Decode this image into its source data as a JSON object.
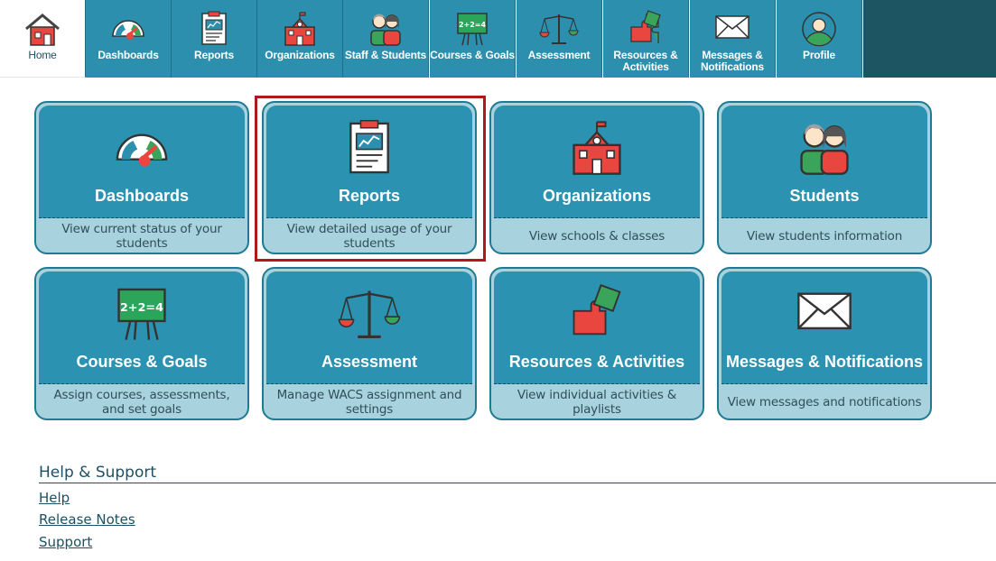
{
  "nav": {
    "items": [
      {
        "label": "Home",
        "icon": "house-icon",
        "active": true
      },
      {
        "label": "Dashboards",
        "icon": "gauge-icon"
      },
      {
        "label": "Reports",
        "icon": "report-clipboard-icon"
      },
      {
        "label": "Organizations",
        "icon": "school-building-icon"
      },
      {
        "label": "Staff & Students",
        "icon": "people-icon"
      },
      {
        "label": "Courses & Goals",
        "icon": "chalkboard-icon"
      },
      {
        "label": "Assessment",
        "icon": "scale-icon"
      },
      {
        "label": "Resources & Activities",
        "icon": "puzzle-icon"
      },
      {
        "label": "Messages & Notifications",
        "icon": "envelope-icon"
      },
      {
        "label": "Profile",
        "icon": "profile-icon"
      }
    ]
  },
  "tiles": [
    {
      "title": "Dashboards",
      "desc": "View current status of your students",
      "icon": "gauge-icon"
    },
    {
      "title": "Reports",
      "desc": "View detailed usage of your students",
      "icon": "report-clipboard-icon",
      "highlighted": true
    },
    {
      "title": "Organizations",
      "desc": "View schools & classes",
      "icon": "school-building-icon"
    },
    {
      "title": "Students",
      "desc": "View students information",
      "icon": "people-icon"
    },
    {
      "title": "Courses & Goals",
      "desc": "Assign courses, assessments, and set goals",
      "icon": "chalkboard-icon"
    },
    {
      "title": "Assessment",
      "desc": "Manage WACS assignment and settings",
      "icon": "scale-icon"
    },
    {
      "title": "Resources & Activities",
      "desc": "View individual activities & playlists",
      "icon": "puzzle-icon"
    },
    {
      "title": "Messages & Notifications",
      "desc": "View messages and notifications",
      "icon": "envelope-icon"
    }
  ],
  "help": {
    "title": "Help & Support",
    "links": [
      "Help",
      "Release Notes",
      "Support"
    ]
  },
  "colors": {
    "nav_bg": "#2b8fad",
    "nav_dark": "#1e5563",
    "tile_top": "#2b93b1",
    "tile_bottom": "#a8d2de",
    "highlight": "#b0171f"
  }
}
